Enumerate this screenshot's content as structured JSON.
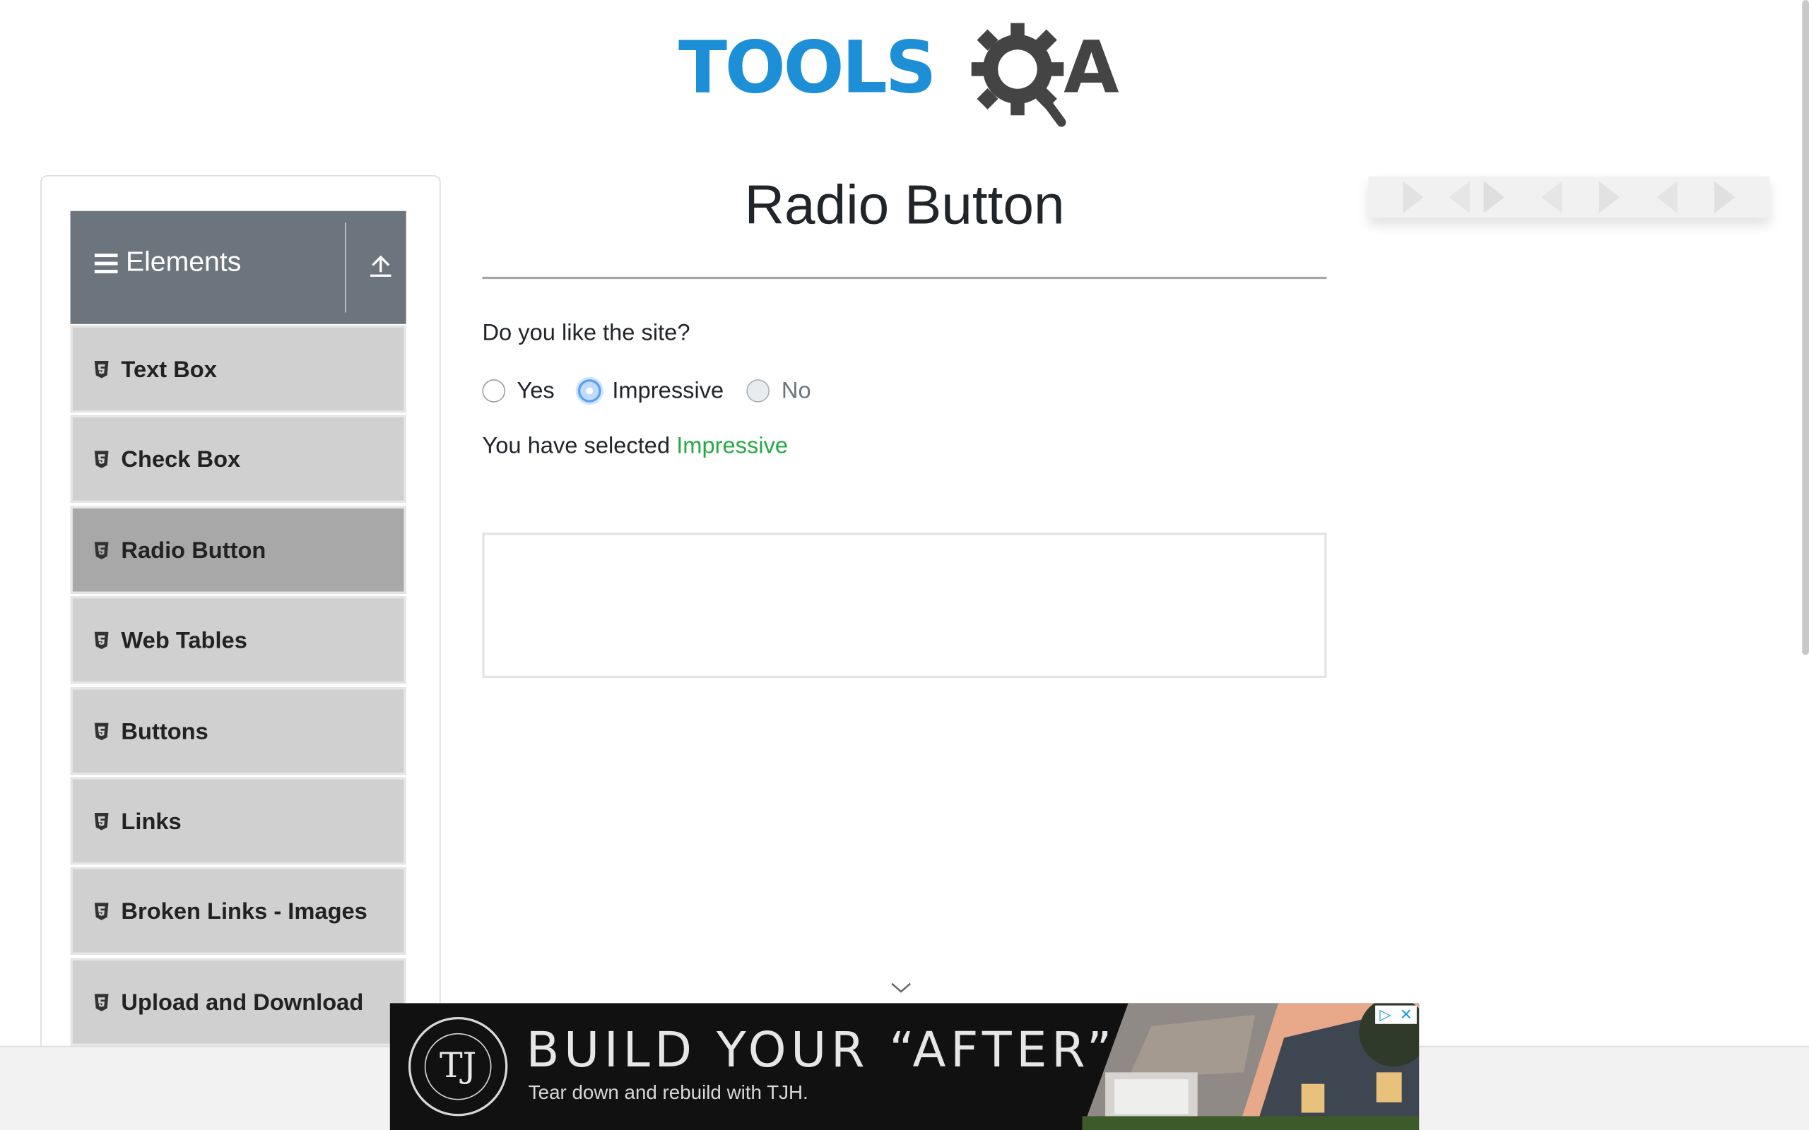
{
  "logo": {
    "part1": "TOOLS",
    "part2": "A"
  },
  "sidebar": {
    "group_title": "Elements",
    "items": [
      {
        "label": "Text Box",
        "active": false
      },
      {
        "label": "Check Box",
        "active": false
      },
      {
        "label": "Radio Button",
        "active": true
      },
      {
        "label": "Web Tables",
        "active": false
      },
      {
        "label": "Buttons",
        "active": false
      },
      {
        "label": "Links",
        "active": false
      },
      {
        "label": "Broken Links - Images",
        "active": false
      },
      {
        "label": "Upload and Download",
        "active": false
      }
    ]
  },
  "main": {
    "title": "Radio Button",
    "question": "Do you like the site?",
    "options": [
      {
        "label": "Yes",
        "checked": false,
        "disabled": false
      },
      {
        "label": "Impressive",
        "checked": true,
        "disabled": false
      },
      {
        "label": "No",
        "checked": false,
        "disabled": true
      }
    ],
    "result_prefix": "You have selected",
    "result_value": "Impressive"
  },
  "ad": {
    "badge_text": "TJ",
    "headline": "BUILD YOUR “AFTER”",
    "subtext": "Tear down and rebuild with TJH."
  },
  "colors": {
    "brand_blue": "#1d8fd6",
    "sidebar_header": "#6c757d",
    "menu_item": "#d0d0d0",
    "menu_item_active": "#a8a8a8",
    "success_text": "#28a745",
    "radio_checked": "#5aa0f0"
  }
}
